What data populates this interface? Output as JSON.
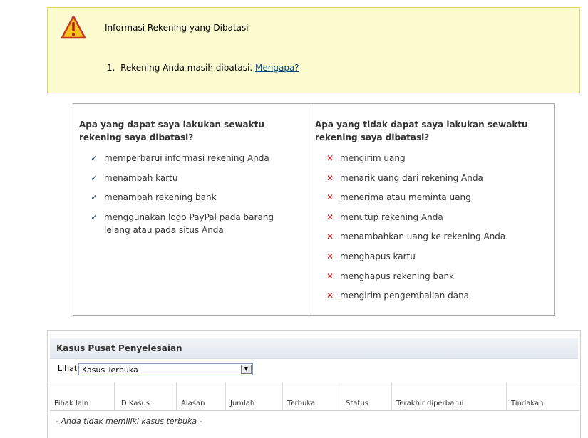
{
  "alert": {
    "title": "Informasi Rekening yang Dibatasi",
    "items": [
      {
        "number": "1.",
        "text": "Rekening Anda masih dibatasi.",
        "link": "Mengapa?"
      }
    ]
  },
  "capabilities": {
    "can": {
      "heading": "Apa yang dapat saya lakukan sewaktu rekening saya dibatasi?",
      "icon": "checkmark-icon",
      "items": [
        "memperbarui informasi rekening Anda",
        "menambah kartu",
        "menambah rekening bank",
        "menggunakan logo PayPal pada barang lelang atau pada situs Anda"
      ]
    },
    "cannot": {
      "heading": "Apa yang tidak dapat saya lakukan sewaktu rekening saya dibatasi?",
      "icon": "cross-icon",
      "items": [
        "mengirim uang",
        "menarik uang dari rekening Anda",
        "menerima atau meminta uang",
        "menutup rekening Anda",
        "menambahkan uang ke rekening Anda",
        "menghapus kartu",
        "menghapus rekening bank",
        "mengirim pengembalian dana"
      ]
    }
  },
  "cases": {
    "title": "Kasus Pusat Penyelesaian",
    "filter_label": "Lihat:",
    "filter_value": "Kasus Terbuka",
    "columns": [
      "Pihak lain",
      "ID Kasus",
      "Alasan",
      "Jumlah",
      "Terbuka",
      "Status",
      "Terakhir diperbarui",
      "Tindakan"
    ],
    "empty_message": "- Anda tidak memiliki kasus terbuka -"
  },
  "colors": {
    "alert_bg": "#fdfbd0",
    "alert_border": "#e6d65f",
    "check": "#1e4f86",
    "cross": "#c8161d",
    "link": "#084482"
  }
}
